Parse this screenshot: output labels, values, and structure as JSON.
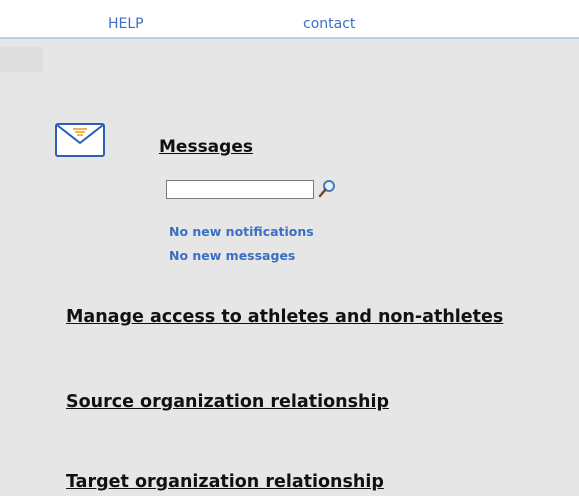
{
  "topbar": {
    "help_label": "HELP",
    "contact_label": "contact"
  },
  "messages": {
    "title": "Messages",
    "search": {
      "value": "",
      "placeholder": ""
    },
    "notifications_text": "No new notifications",
    "messages_text": "No new messages"
  },
  "links": {
    "manage_access": "Manage access to athletes and non-athletes",
    "source_org": "Source organization relationship",
    "target_org": "Target organization relationship"
  },
  "icons": {
    "mail": "envelope-icon",
    "search": "magnifier-icon"
  },
  "colors": {
    "link_blue": "#3a6fc4",
    "background": "#e6e6e6"
  }
}
